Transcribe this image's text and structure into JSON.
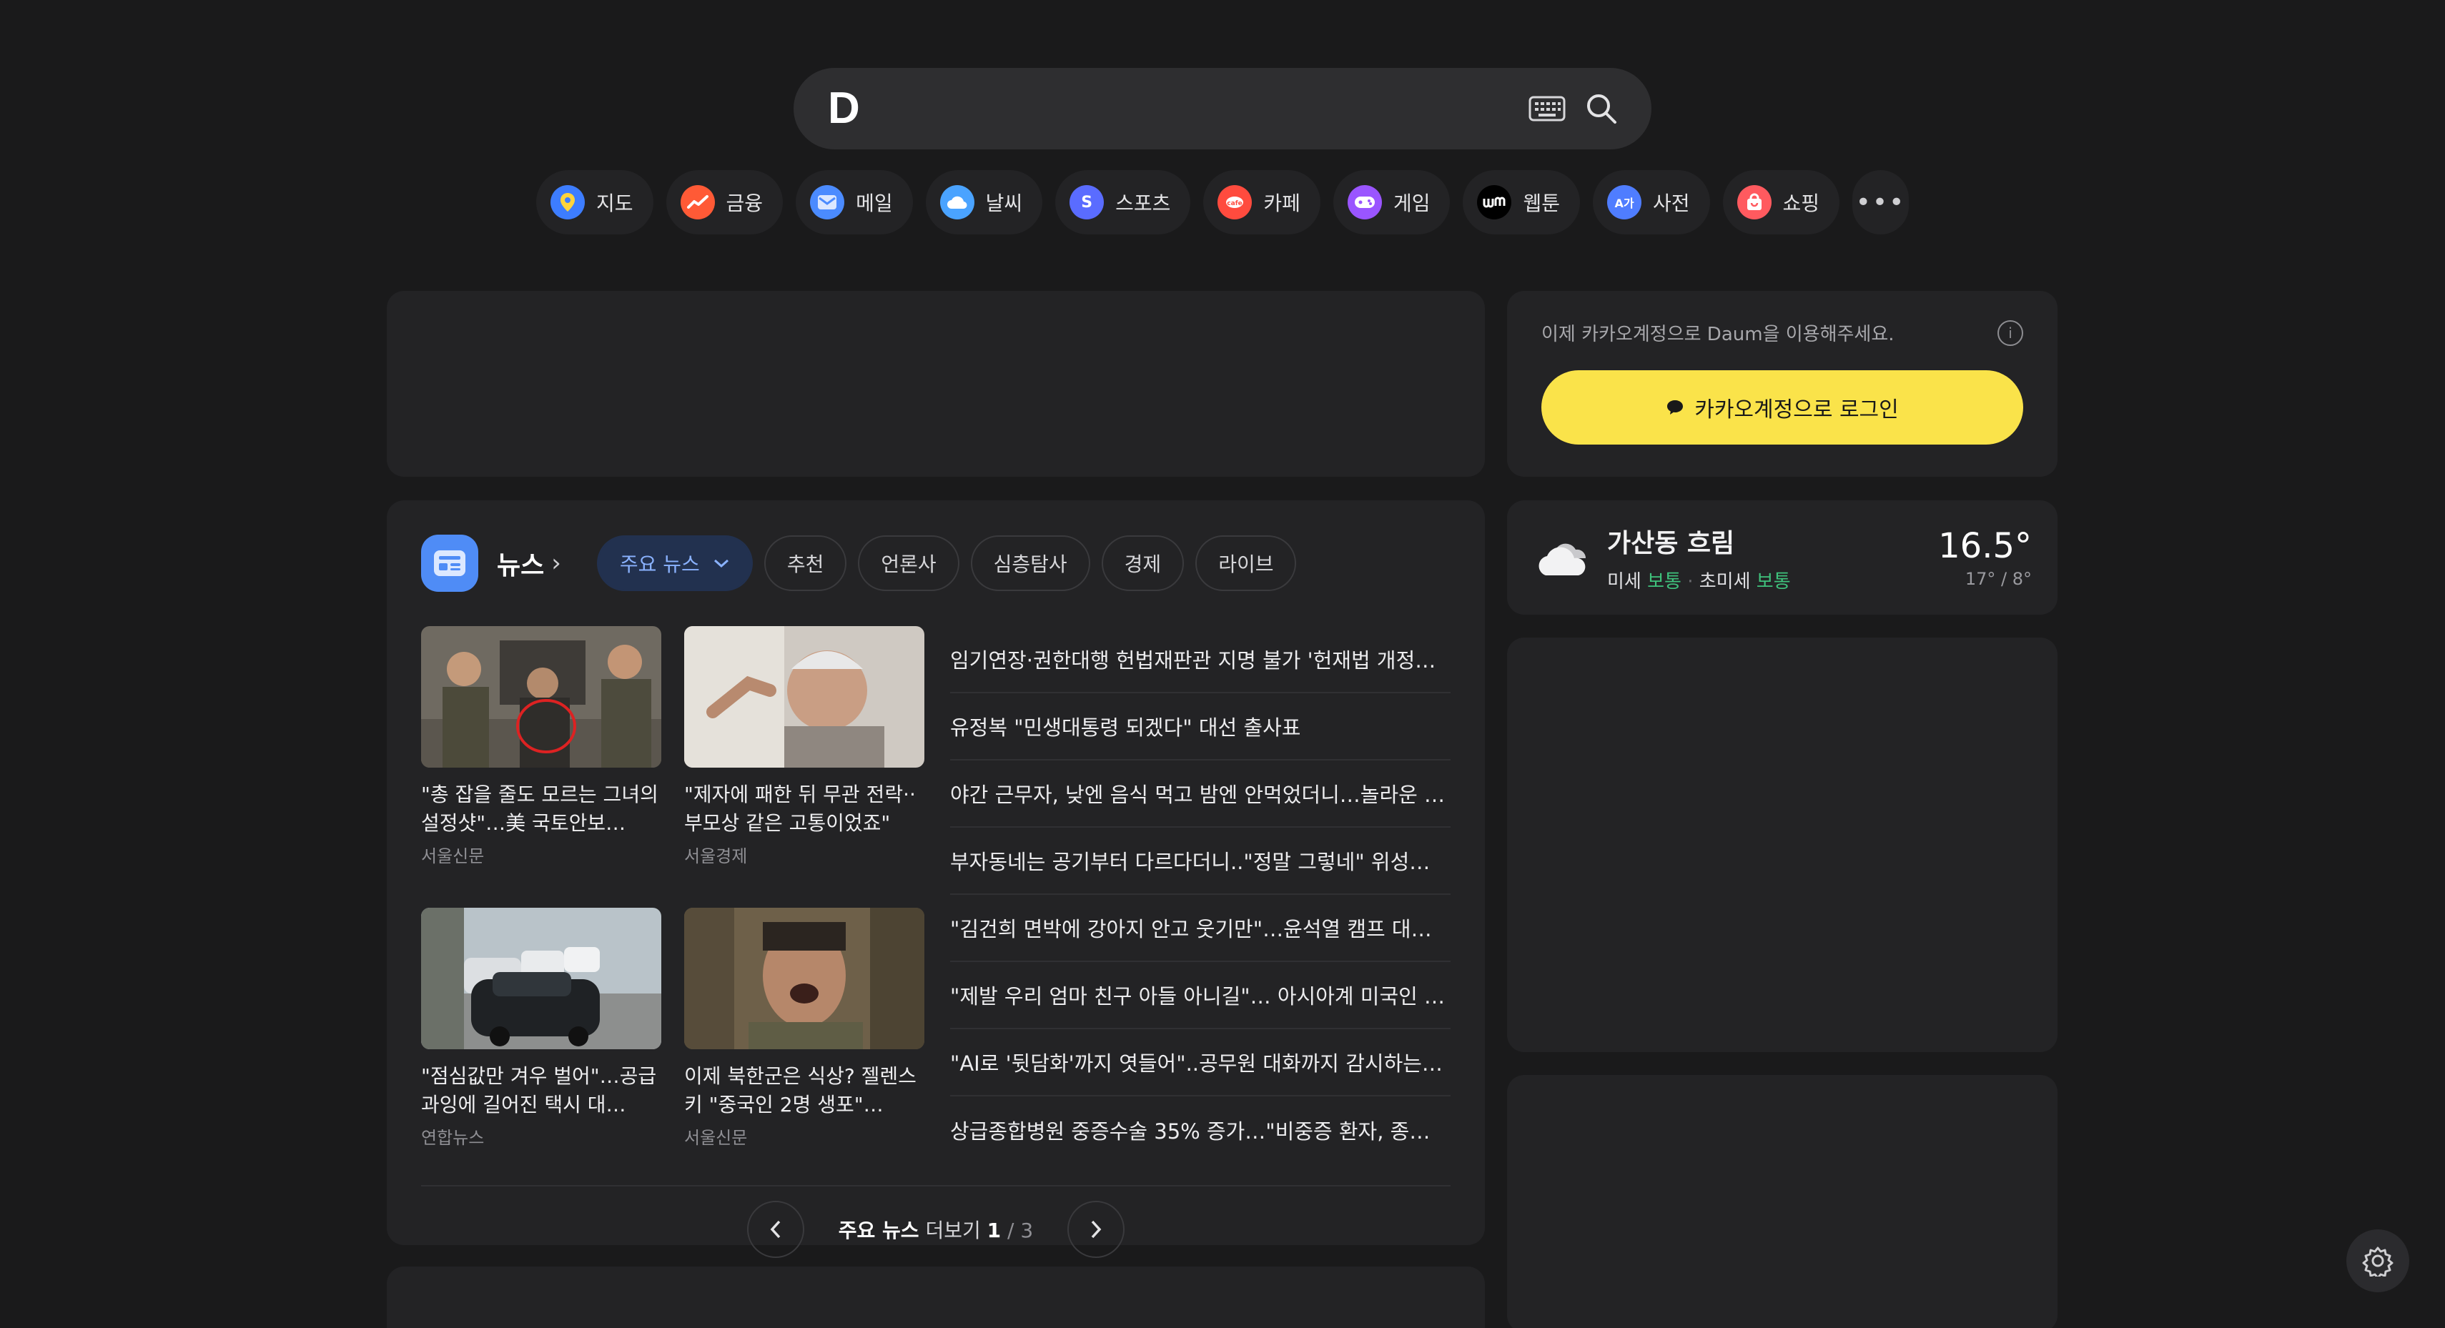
{
  "search": {
    "logo": "D",
    "placeholder": "",
    "keyboard_icon": "keyboard-icon",
    "search_icon": "search-icon"
  },
  "services": [
    {
      "label": "지도",
      "icon": "map-pin-icon",
      "color": "#3d7dff"
    },
    {
      "label": "금융",
      "icon": "finance-chart-icon",
      "color": "#ff5a36"
    },
    {
      "label": "메일",
      "icon": "mail-icon",
      "color": "#4b8bff"
    },
    {
      "label": "날씨",
      "icon": "cloud-icon",
      "color": "#4aa3ff"
    },
    {
      "label": "스포츠",
      "icon": "sports-icon",
      "color": "#5a6cff"
    },
    {
      "label": "카페",
      "icon": "cafe-icon",
      "color": "#ff4b3e"
    },
    {
      "label": "게임",
      "icon": "game-icon",
      "color": "#9a55ff"
    },
    {
      "label": "웹툰",
      "icon": "webtoon-icon",
      "color": "#000000"
    },
    {
      "label": "사전",
      "icon": "dictionary-icon",
      "color": "#4f7dff"
    },
    {
      "label": "쇼핑",
      "icon": "shopping-bag-icon",
      "color": "#ff5a5f"
    }
  ],
  "more_label": "•••",
  "login": {
    "note": "이제 카카오계정으로 Daum을 이용해주세요.",
    "button": "카카오계정으로 로그인",
    "button_color": "#fae34a"
  },
  "weather": {
    "location": "가산동 흐림",
    "dust_label": "미세",
    "dust_value": "보통",
    "fine_dust_label": "초미세",
    "fine_dust_value": "보통",
    "temperature": "16.5°",
    "range": "17° / 8°"
  },
  "news": {
    "title": "뉴스",
    "tabs": [
      "주요 뉴스",
      "추천",
      "언론사",
      "심층탐사",
      "경제",
      "라이브"
    ],
    "thumbs": [
      {
        "title": "\"총 잡을 줄도 모르는 그녀의 설정샷\"…美 국토안보…",
        "source": "서울신문"
      },
      {
        "title": "\"제자에 패한 뒤 무관 전락··부모상 같은 고통이었죠\"",
        "source": "서울경제"
      },
      {
        "title": "\"점심값만 겨우 벌어\"…공급과잉에 길어진 택시 대…",
        "source": "연합뉴스"
      },
      {
        "title": "이제 북한군은 식상? 젤렌스키 \"중국인 2명 생포\"…",
        "source": "서울신문"
      }
    ],
    "headlines": [
      "임기연장·권한대행 헌법재판관 지명 불가 '헌재법 개정…",
      "유정복 \"민생대통령 되겠다\" 대선 출사표",
      "야간 근무자, 낮엔 음식 먹고 밤엔 안먹었더니…놀라운 …",
      "부자동네는 공기부터 다르다더니..\"정말 그렇네\" 위성…",
      "\"김건희 면박에 강아지 안고 웃기만\"…윤석열 캠프 대…",
      "\"제발 우리 엄마 친구 아들 아니길\"… 아시아계 미국인 …",
      "\"AI로 '뒷담화'까지 엿들어\"..공무원 대화까지 감시하는…",
      "상급종합병원 중증수술 35% 증가…\"비중증 환자, 종…"
    ],
    "pager": {
      "label_bold": "주요 뉴스",
      "label": "더보기",
      "current": "1",
      "sep": "/",
      "total": "3"
    }
  }
}
